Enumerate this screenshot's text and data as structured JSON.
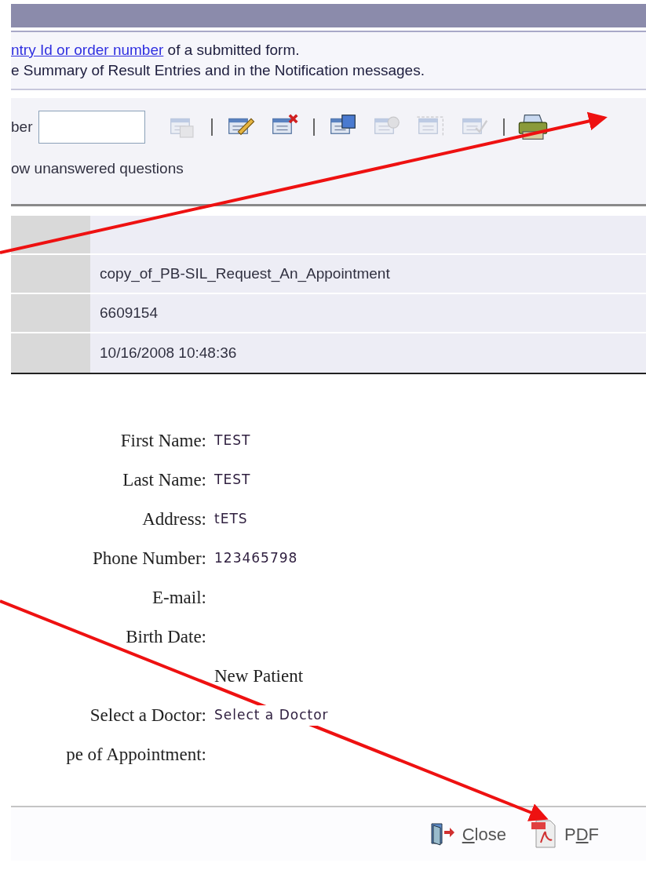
{
  "intro": {
    "link": "ntry Id or order number",
    "after": " of a submitted form.",
    "line2": "e Summary of Result Entries and in the Notification messages."
  },
  "search": {
    "label": "ber"
  },
  "toolbar": [
    {
      "kind": "button",
      "disabled": true
    },
    {
      "kind": "separator"
    },
    {
      "kind": "button",
      "disabled": false
    },
    {
      "kind": "button",
      "disabled": false
    },
    {
      "kind": "separator"
    },
    {
      "kind": "button",
      "disabled": false
    },
    {
      "kind": "button",
      "disabled": true
    },
    {
      "kind": "button",
      "disabled": true
    },
    {
      "kind": "button",
      "disabled": true
    },
    {
      "kind": "separator"
    },
    {
      "kind": "button",
      "disabled": false
    }
  ],
  "option": "ow unanswered questions",
  "info_rows": [
    {},
    {
      "value": "copy_of_PB-SIL_Request_An_Appointment"
    },
    {
      "value": "6609154"
    },
    {
      "value": "10/16/2008 10:48:36"
    }
  ],
  "form_fields": [
    {
      "label": "First Name:",
      "value": "TEST"
    },
    {
      "label": "Last Name:",
      "value": "TEST"
    },
    {
      "label": "Address:",
      "value": "tETS"
    },
    {
      "label": "Phone Number:",
      "value": "123465798"
    },
    {
      "label": "E-mail:"
    },
    {
      "label": "Birth Date:"
    },
    {
      "value": "New Patient",
      "kind": "heading"
    },
    {
      "label": "Select a Doctor:",
      "value": "Select a Doctor"
    },
    {
      "label": "pe of Appointment:"
    }
  ],
  "footer_buttons": [
    {
      "kind": "close",
      "key": "C",
      "after": "lose"
    },
    {
      "kind": "pdf",
      "before": "P",
      "key": "D",
      "after": "F"
    }
  ]
}
